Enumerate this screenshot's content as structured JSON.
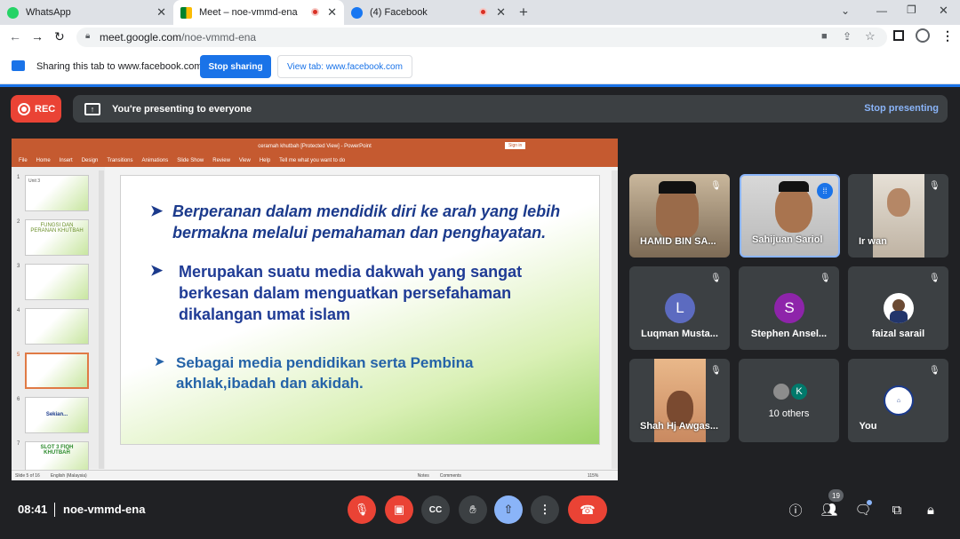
{
  "browser": {
    "tabs": [
      {
        "title": "WhatsApp"
      },
      {
        "title": "Meet – noe-vmmd-ena"
      },
      {
        "title": "(4) Facebook"
      }
    ],
    "url_host": "meet.google.com",
    "url_path": "/noe-vmmd-ena"
  },
  "sharing": {
    "message": "Sharing this tab to www.facebook.com",
    "stop_label": "Stop sharing",
    "view_label": "View tab: www.facebook.com"
  },
  "meet": {
    "rec_label": "REC",
    "presenting_message": "You're presenting to everyone",
    "stop_presenting_label": "Stop presenting",
    "time": "08:41",
    "meeting_code": "noe-vmmd-ena",
    "participant_count": "19"
  },
  "ppt": {
    "window_title": "ceramah khutbah [Protected View] - PowerPoint",
    "sign_in": "Sign in",
    "menu": [
      "File",
      "Home",
      "Insert",
      "Design",
      "Transitions",
      "Animations",
      "Slide Show",
      "Review",
      "View",
      "Help"
    ],
    "tell_me": "Tell me what you want to do",
    "thumbs": [
      {
        "num": "1",
        "text": "Unit 3"
      },
      {
        "num": "2",
        "text": "FUNGSI DAN PERANAN KHUTBAH"
      },
      {
        "num": "3",
        "text": ""
      },
      {
        "num": "4",
        "text": ""
      },
      {
        "num": "5",
        "text": ""
      },
      {
        "num": "6",
        "text": "Sekian..."
      },
      {
        "num": "7",
        "text": "SLOT 3 FIQH KHUTBAH"
      }
    ],
    "slide": {
      "bullet1": "Berperanan  dalam mendidik diri ke arah yang lebih bermakna melalui pemahaman dan penghayatan.",
      "bullet2": "Merupakan suatu media dakwah yang sangat berkesan dalam menguatkan persefahaman dikalangan umat islam",
      "bullet3": "Sebagai media pendidikan serta Pembina akhlak,ibadah dan akidah."
    },
    "status_slide": "Slide 5 of 16",
    "status_lang": "English (Malaysia)",
    "status_notes": "Notes",
    "status_comments": "Comments",
    "zoom": "115%"
  },
  "participants": [
    {
      "name": "HAMID BIN SA...",
      "initial": ""
    },
    {
      "name": "Sahijuan Sariol",
      "initial": ""
    },
    {
      "name": "Ir wan",
      "initial": ""
    },
    {
      "name": "Luqman Musta...",
      "initial": "L",
      "color": "#5c6bc0"
    },
    {
      "name": "Stephen Ansel...",
      "initial": "S",
      "color": "#8e24aa"
    },
    {
      "name": "faizal sarail",
      "initial": ""
    },
    {
      "name": "Shah Hj Awgas...",
      "initial": ""
    },
    {
      "name": "10 others",
      "initial": "K",
      "color": "#00796b"
    },
    {
      "name": "You",
      "initial": ""
    }
  ],
  "colors": {
    "accent": "#1a73e8",
    "danger": "#ea4335",
    "present": "#8ab4f8",
    "ppt": "#c55a30"
  }
}
